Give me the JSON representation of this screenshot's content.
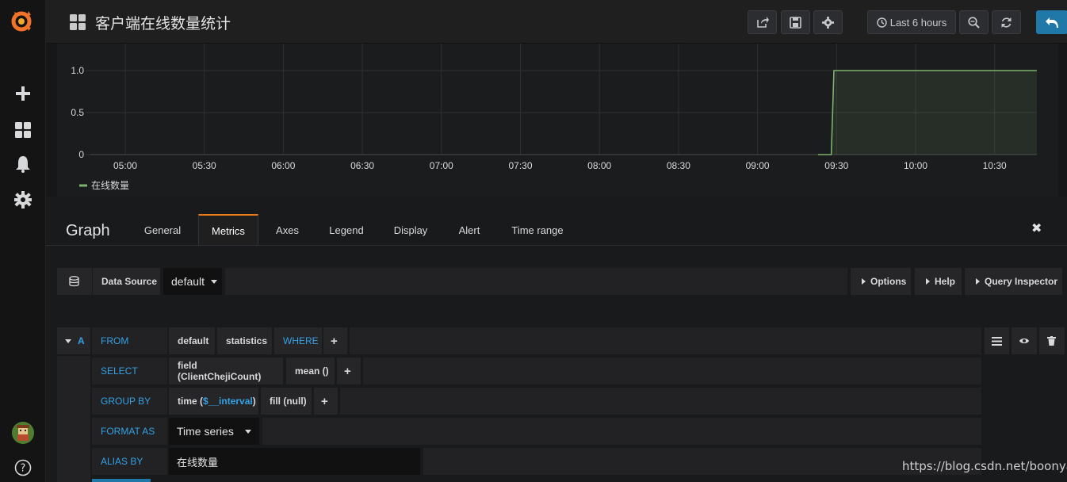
{
  "dashboard": {
    "title": "客户端在线数量统计"
  },
  "navbar": {
    "time_range_label": "Last 6 hours"
  },
  "chart_data": {
    "type": "area",
    "x": [
      "05:00",
      "05:30",
      "06:00",
      "06:30",
      "07:00",
      "07:30",
      "08:00",
      "08:30",
      "09:00",
      "09:30",
      "10:00",
      "10:30"
    ],
    "yticks": [
      "0",
      "0.5",
      "1.0"
    ],
    "ylim": [
      0,
      1.0
    ],
    "series": [
      {
        "name": "在线数量",
        "color": "#7eb26d",
        "points": [
          [
            "09:23",
            0
          ],
          [
            "09:28",
            0
          ],
          [
            "09:29",
            1.0
          ],
          [
            "10:46",
            1.0
          ]
        ]
      }
    ],
    "legend": "bottom-left",
    "grid": true
  },
  "editor": {
    "title": "Graph",
    "tabs": [
      "General",
      "Metrics",
      "Axes",
      "Legend",
      "Display",
      "Alert",
      "Time range"
    ],
    "active_tab": "Metrics"
  },
  "datasource": {
    "label": "Data Source",
    "value": "default",
    "options_label": "Options",
    "help_label": "Help",
    "inspector_label": "Query Inspector"
  },
  "query": {
    "ref_id": "A",
    "from_label": "FROM",
    "policy": "default",
    "measurement": "statistics",
    "where_label": "WHERE",
    "select_label": "SELECT",
    "field": "field (ClientChejiCount)",
    "aggregation": "mean ()",
    "group_by_label": "GROUP BY",
    "time_prefix": "time (",
    "time_interval": "$__interval",
    "time_suffix": ")",
    "fill": "fill (null)",
    "format_label": "FORMAT AS",
    "format_value": "Time series",
    "alias_label": "ALIAS BY",
    "alias_value": "在线数量",
    "plus": "+"
  },
  "watermark": "https://blog.csdn.net/boonya",
  "colors": {
    "accent": "#eb7b18",
    "link": "#33a2e5",
    "series": "#7eb26d",
    "primary_button": "#1f78a8"
  }
}
